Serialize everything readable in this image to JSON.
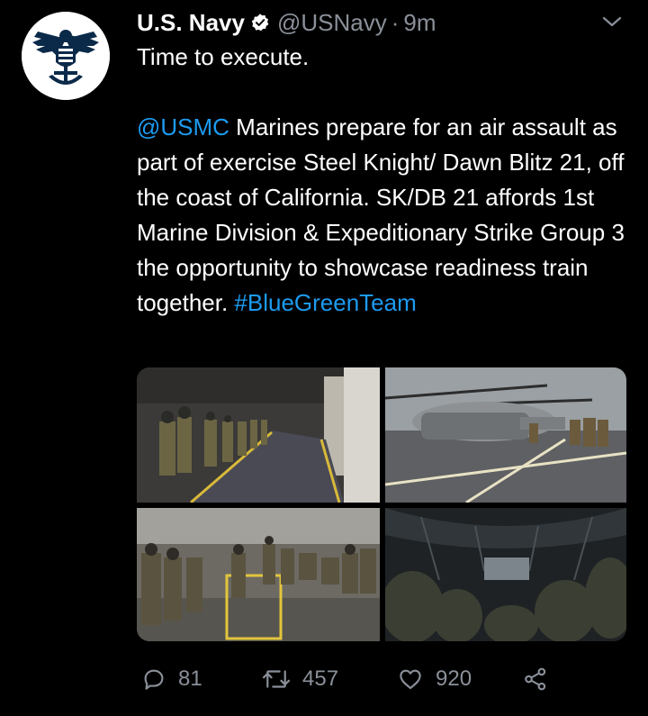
{
  "tweet": {
    "author_name": "U.S. Navy",
    "handle": "@USNavy",
    "separator": "·",
    "time": "9m",
    "line1": "Time to execute.",
    "mention": "@USMC",
    "body_1": " Marines prepare for an air assault as part of exercise Steel Knight/ Dawn Blitz 21, off the coast of California. SK/DB 21 affords 1st Marine Division & Expeditionary Strike Group 3 the opportunity to showcase readiness train together. ",
    "hashtag": "#BlueGreenTeam"
  },
  "actions": {
    "replies": "81",
    "retweets": "457",
    "likes": "920"
  },
  "icons": {
    "avatar": "navy-eagle-logo",
    "verified": "verified-badge-icon",
    "caret": "chevron-down-icon",
    "reply": "reply-icon",
    "retweet": "retweet-icon",
    "like": "heart-icon",
    "share": "share-icon"
  },
  "colors": {
    "background": "#000000",
    "link": "#1d9bf0",
    "muted": "#8a9099",
    "navy": "#0b2a4a"
  }
}
